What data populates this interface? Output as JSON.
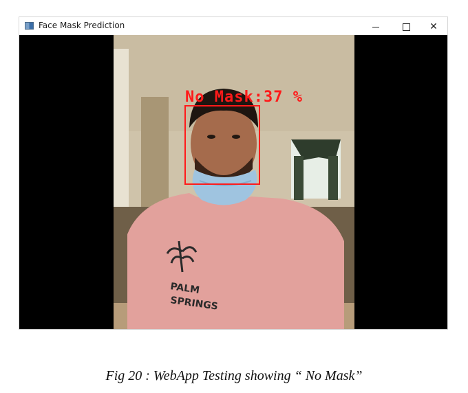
{
  "window": {
    "title": "Face Mask Prediction",
    "controls": {
      "minimize_icon": "minimize-icon",
      "maximize_icon": "maximize-icon",
      "close_icon": "close-icon",
      "close_glyph": "✕"
    }
  },
  "camera_feed": {
    "prediction_label": "No Mask:37 %",
    "box_color": "#ff1a1a"
  },
  "caption": "Fig 20 : WebApp Testing showing “ No Mask”"
}
